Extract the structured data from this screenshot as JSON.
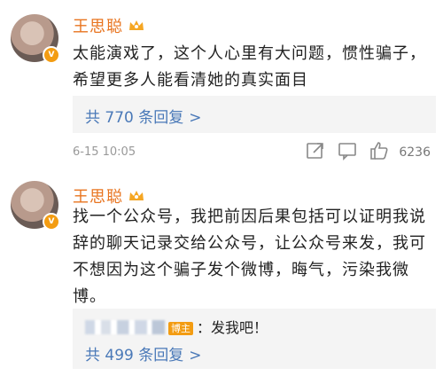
{
  "comments": [
    {
      "username": "王思聪",
      "text": "太能演戏了，这个人心里有大问题，惯性骗子，希望更多人能看清她的真实面目",
      "replies_label": "共",
      "replies_count": "770",
      "replies_suffix": "条回复",
      "timestamp": "6-15 10:05",
      "likes": "6236"
    },
    {
      "username": "王思聪",
      "text": "找一个公众号，我把前因后果包括可以证明我说辞的聊天记录交给公众号，让公众号来发，我可不想因为这个骗子发个微博，晦气，污染我微博。",
      "sub_reply_badge": "博主",
      "sub_reply_text": "：发我吧！",
      "replies_label": "共",
      "replies_count": "499",
      "replies_suffix": "条回复"
    }
  ],
  "icons": {
    "verified": "verified-badge-icon",
    "crown": "crown-icon",
    "share": "share-icon",
    "comment": "comment-icon",
    "like": "thumbs-up-icon",
    "arrow": "chevron-right-icon"
  },
  "colors": {
    "username": "#e8741f",
    "link": "#4a79b8",
    "badge": "#f39c12"
  }
}
